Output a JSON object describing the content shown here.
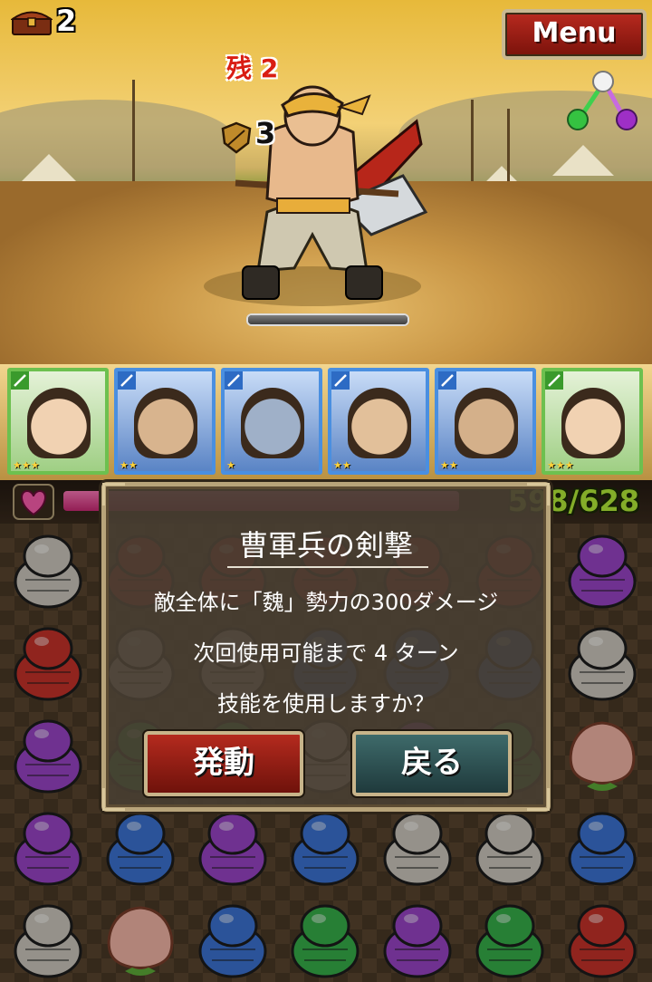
{
  "hud": {
    "chest_count": "2",
    "menu_label": "Menu",
    "attribute_cycle": [
      "white",
      "purple",
      "green"
    ]
  },
  "enemy": {
    "remaining_label": "残",
    "remaining_count": "2",
    "turn_counter": "3",
    "hp_fraction": 1.0
  },
  "party": {
    "members": [
      {
        "frame": "green",
        "type_icon": "sword-icon",
        "stars": "★★★"
      },
      {
        "frame": "blue",
        "type_icon": "sword-icon",
        "stars": "★★"
      },
      {
        "frame": "blue",
        "type_icon": "sword-icon",
        "stars": "★"
      },
      {
        "frame": "blue",
        "type_icon": "spear-icon",
        "stars": "★★"
      },
      {
        "frame": "blue",
        "type_icon": "spear-icon",
        "stars": "★★"
      },
      {
        "frame": "green",
        "type_icon": "sword-icon",
        "stars": "★★★"
      }
    ]
  },
  "player_hp": {
    "current": "598",
    "max": "628",
    "display": "598/628",
    "fraction": 0.95
  },
  "dialog": {
    "title": "曹軍兵の剣撃",
    "effect": "敵全体に「魏」勢力の300ダメージ",
    "cooldown": "次回使用可能まで 4 ターン",
    "prompt": "技能を使用しますか？",
    "activate_label": "発動",
    "back_label": "戻る"
  },
  "colors": {
    "red": "#c8322a",
    "purple": "#9a45c8",
    "white": "#cfcac0",
    "blue": "#3c74d4",
    "green": "#36b04a",
    "peach": "#f5b8a8",
    "hp_pink": "#ff6fae",
    "hp_text": "#b8f03a"
  },
  "board": {
    "rows": [
      [
        "white",
        "red",
        "red",
        "red",
        "red",
        "red",
        "purple"
      ],
      [
        "red",
        "white",
        "white",
        "blue",
        "blue",
        "blue",
        "white"
      ],
      [
        "purple",
        "green",
        "green",
        "white",
        "purple",
        "green",
        "peach"
      ],
      [
        "purple",
        "blue",
        "purple",
        "blue",
        "white",
        "white",
        "blue"
      ],
      [
        "white",
        "peach",
        "blue",
        "green",
        "purple",
        "green",
        "red"
      ]
    ]
  }
}
